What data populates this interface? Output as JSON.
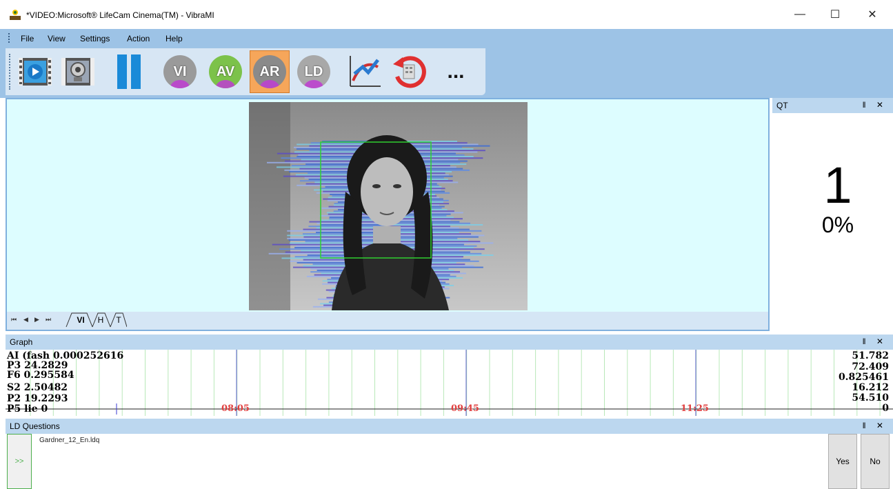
{
  "window": {
    "title": "*VIDEO:Microsoft® LifeCam Cinema(TM) - VibraMI",
    "minimize_icon": "—",
    "maximize_icon": "☐",
    "close_icon": "✕"
  },
  "menu": {
    "items": [
      "File",
      "View",
      "Settings",
      "Action",
      "Help"
    ]
  },
  "toolbar": {
    "buttons": [
      {
        "name": "play-video-icon"
      },
      {
        "name": "webcam-icon"
      },
      {
        "name": "pause-icon"
      },
      {
        "label": "VI",
        "color": "#9a9a9a"
      },
      {
        "label": "AV",
        "color": "#7cc24a"
      },
      {
        "label": "AR",
        "color": "#8a8a8a",
        "active": true
      },
      {
        "label": "LD",
        "color": "#a8a8a8"
      },
      {
        "name": "chart-icon"
      },
      {
        "name": "reset-icon"
      },
      {
        "label": "..."
      }
    ]
  },
  "video_tabs": {
    "nav": [
      "⏮",
      "◀",
      "▶",
      "⏭"
    ],
    "tabs": [
      "VI",
      "H",
      "T"
    ]
  },
  "qt_panel": {
    "title": "QT",
    "controls": "‖ ✕",
    "value": "1",
    "percent": "0%"
  },
  "graph_panel": {
    "title": "Graph",
    "controls": "‖ ✕",
    "left_labels": [
      "AI  (fash 0.000252616",
      "P3 24.2829",
      "F6 0.295584",
      "S2 2.50482",
      "P2 19.2293",
      "P5 lie 0"
    ],
    "right_labels": [
      "51.782",
      "72.409",
      "0.825461",
      "16.212",
      "54.510",
      "0"
    ],
    "time_labels": [
      "08:05",
      "09:45",
      "11:25"
    ]
  },
  "ld_panel": {
    "title": "LD Questions",
    "controls": "‖ ✕",
    "side_button": ">>",
    "file": "Gardner_12_En.ldq",
    "yes": "Yes",
    "no": "No"
  },
  "colors": {
    "chrome_blue": "#9dc3e6",
    "panel_header": "#bcd7ef",
    "video_bg": "#ddfdff",
    "active_button": "#f6a65a"
  }
}
